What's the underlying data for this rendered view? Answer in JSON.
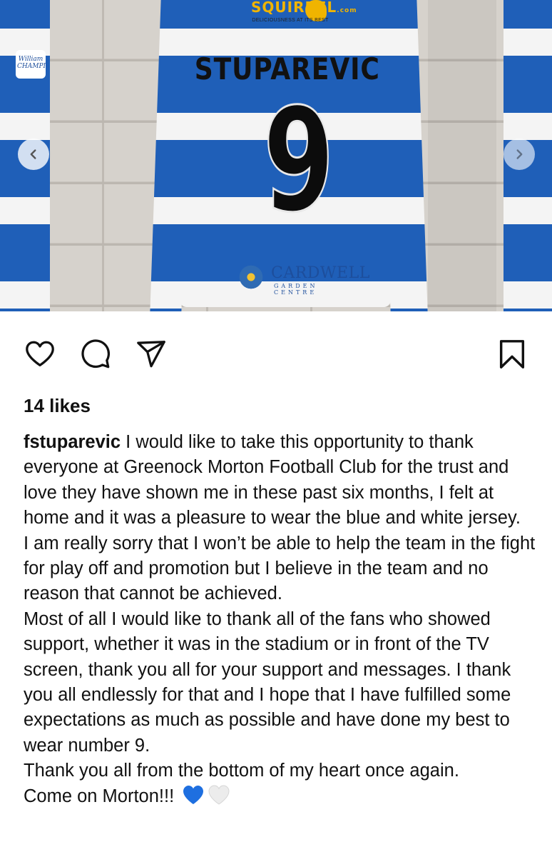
{
  "post": {
    "photo": {
      "player_name": "STUPAREVIC",
      "number": "9",
      "top_sponsor": "SQUIRREL",
      "top_sponsor_domain": ".com",
      "top_sponsor_tagline": "DELICIOUSNESS AT ITS BEST",
      "bottom_sponsor": "CARDWELL",
      "bottom_sponsor_sub": "GARDEN CENTRE",
      "side_badge_line1": "William",
      "side_badge_line2": "CHAMPI",
      "prev_icon": "chevron-left-icon",
      "next_icon": "chevron-right-icon"
    },
    "actions": {
      "like_icon": "heart-outline-icon",
      "comment_icon": "comment-bubble-icon",
      "share_icon": "paper-plane-icon",
      "save_icon": "bookmark-icon"
    },
    "likes_text": "14 likes",
    "caption": {
      "username": "fstuparevic",
      "paragraphs": [
        "I would like to take this opportunity to thank everyone at Greenock Morton Football Club for the trust and love they have shown me in these past six months, I felt at home and it was a pleasure to wear the blue and white jersey.",
        "I am really sorry that I won’t be able to help the team in the fight for play off and promotion but I believe in the team and no reason that cannot be achieved.",
        "Most of all I would like to thank all of the fans who showed support, whether it was in the stadium or in front of the TV screen, thank you all for your support and messages. I thank you all endlessly for that and I hope that I have fulfilled some expectations as much as possible and have done my best to wear number 9.",
        "Thank you all from the bottom of my heart once again.",
        "Come on Morton!!!"
      ],
      "emojis": [
        "blue-heart-icon",
        "white-heart-icon"
      ]
    },
    "colors": {
      "jersey_blue": "#1f5fb8",
      "jersey_white": "#f4f4f4",
      "sponsor_gold": "#f0b400",
      "blue_heart": "#1e6fe0",
      "white_heart": "#e9e9e9"
    }
  }
}
